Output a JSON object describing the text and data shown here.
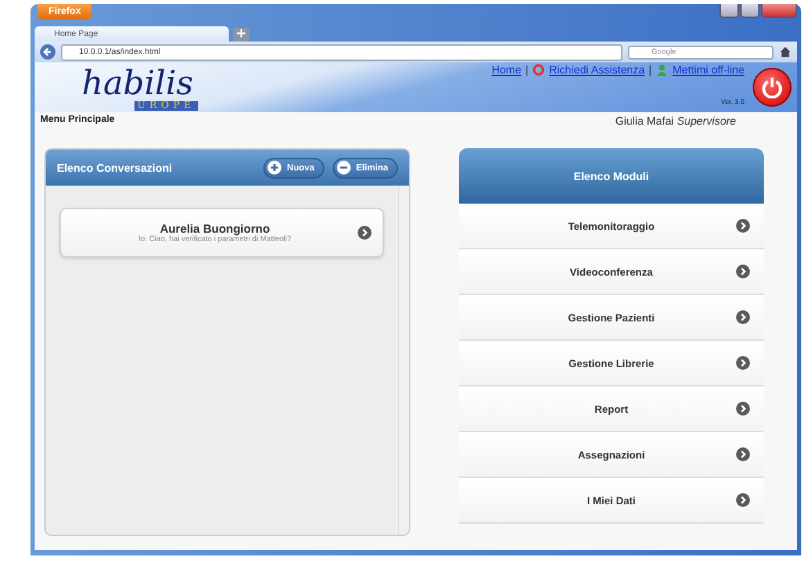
{
  "browser": {
    "menu_button": "Firefox",
    "tab": "Home Page",
    "url": "10.0.0.1/as/index.html",
    "search_placeholder": "Google"
  },
  "header": {
    "logo": "habilis",
    "logo_sub": "UROPE",
    "links": [
      {
        "label": "Home",
        "kind": "plain"
      },
      {
        "label": "Richiedi Assistenza",
        "kind": "help"
      },
      {
        "label": "Mettimi off-line",
        "kind": "status"
      }
    ],
    "separators": [
      "|",
      "|"
    ],
    "version": "Ver. 3.0"
  },
  "page_title": "Menu Principale",
  "user": {
    "name": "Giulia Mafai",
    "role": "Supervisore"
  },
  "conversations": {
    "title": "Elenco Conversazioni",
    "buttons": [
      {
        "label": "Nuova",
        "kind": "add"
      },
      {
        "label": "Elimina",
        "kind": "remove"
      }
    ],
    "items": [
      {
        "name": "Aurelia Buongiorno",
        "preview": "Io: Ciao, hai verificato i parametri di Matteoli?"
      }
    ]
  },
  "modules": {
    "title": "Elenco Moduli",
    "items": [
      "Telemonitoraggio",
      "Videoconferenza",
      "Gestione Pazienti",
      "Gestione Librerie",
      "Report",
      "Assegnazioni",
      "I Miei Dati"
    ]
  }
}
